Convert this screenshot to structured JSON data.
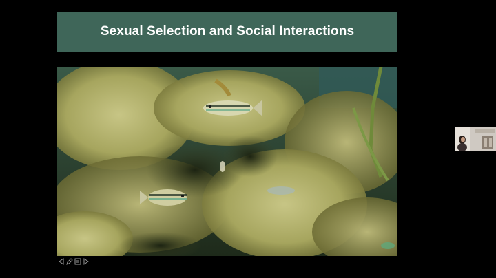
{
  "slide": {
    "title": "Sexual Selection and Social Interactions",
    "title_bar_color": "#3f6659",
    "photo_subject": "underwater-fish-among-algae",
    "controls": [
      {
        "name": "previous-slide",
        "icon": "arrow-left-icon"
      },
      {
        "name": "pen-tool",
        "icon": "pen-icon"
      },
      {
        "name": "slide-menu",
        "icon": "menu-icon"
      },
      {
        "name": "next-slide",
        "icon": "arrow-right-icon"
      }
    ]
  },
  "presenter_video": {
    "icon": "presenter-thumbnail"
  }
}
